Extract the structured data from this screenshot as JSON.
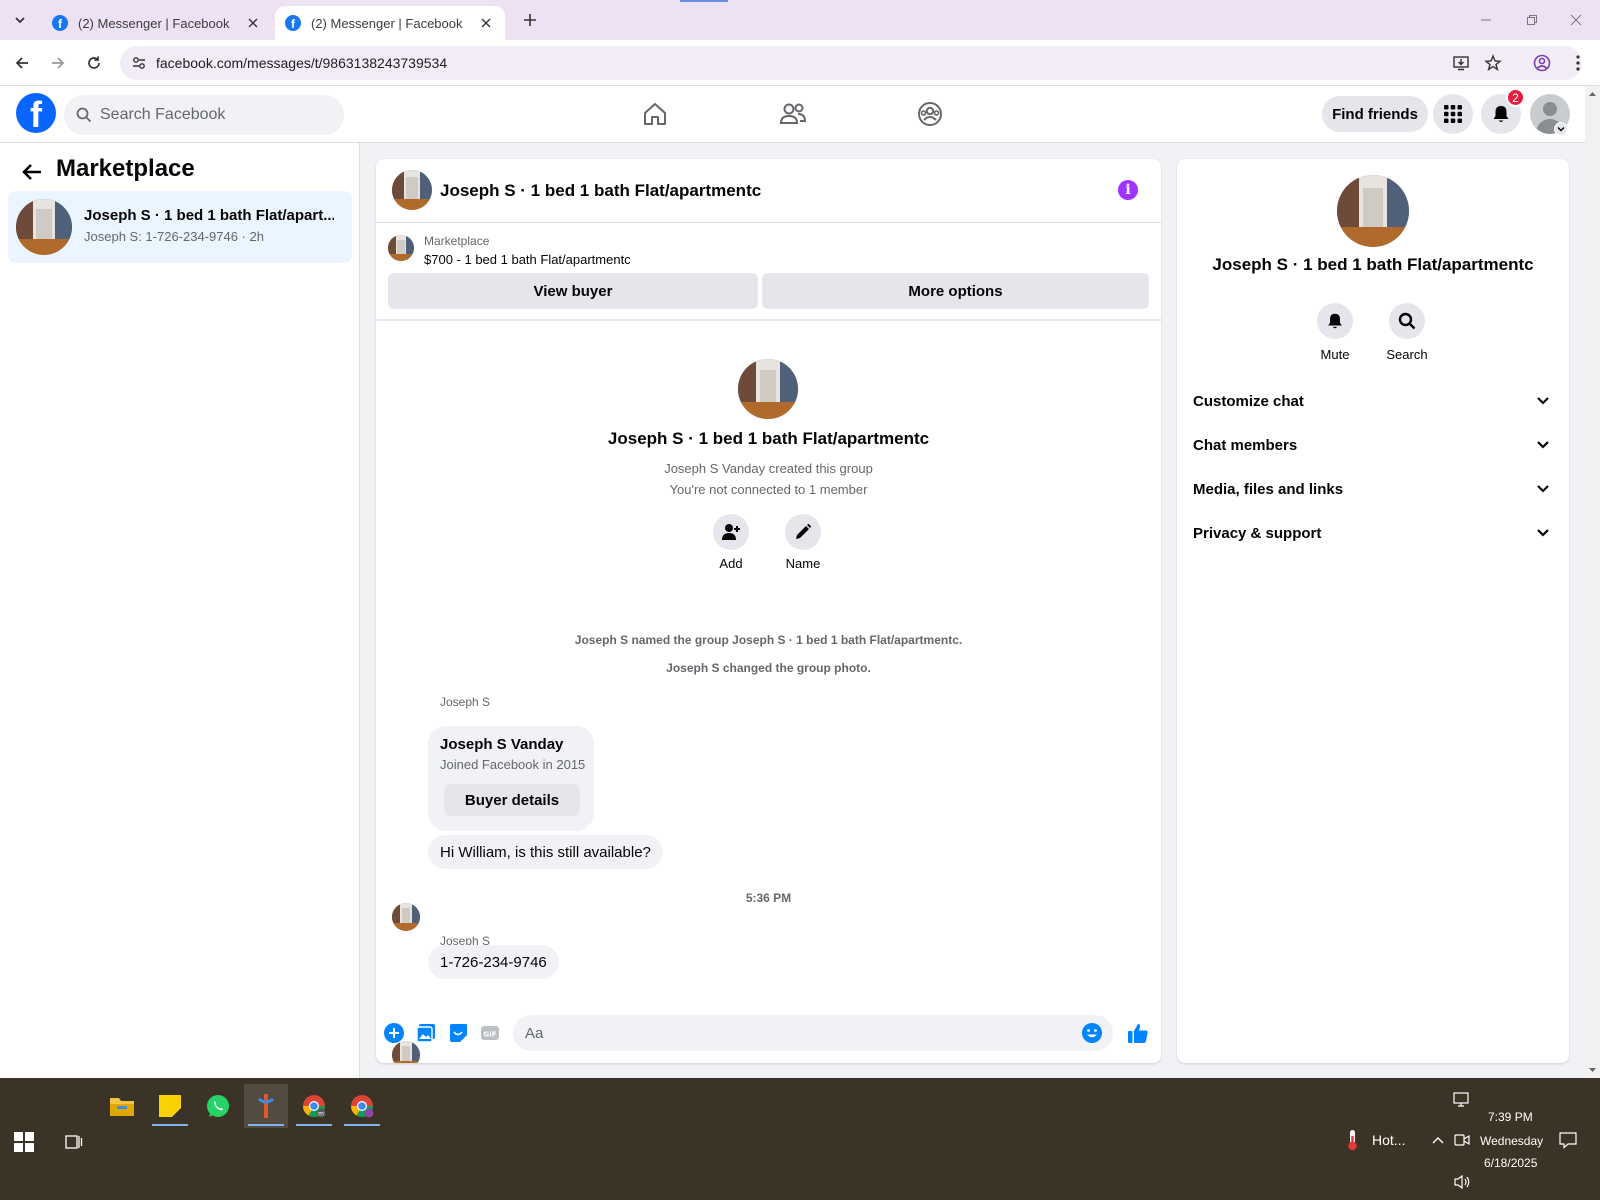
{
  "browser": {
    "tabs": [
      {
        "title": "(2) Messenger | Facebook",
        "active": false
      },
      {
        "title": "(2) Messenger | Facebook",
        "active": true
      }
    ],
    "url": "facebook.com/messages/t/9863138243739534"
  },
  "fb_header": {
    "logo": "f",
    "search_placeholder": "Search Facebook",
    "find_friends_label": "Find friends",
    "notification_count": "2",
    "nav_icons": [
      "home-icon",
      "friends-icon",
      "groups-icon"
    ]
  },
  "left_panel": {
    "title": "Marketplace",
    "conversations": [
      {
        "name": "Joseph S · 1 bed 1 bath Flat/apart...",
        "preview": "Joseph S: 1-726-234-9746 · 2h"
      }
    ]
  },
  "chat": {
    "header_title": "Joseph S · 1 bed 1 bath Flat/apartmentc",
    "listing": {
      "source": "Marketplace",
      "title": "$700 - 1 bed 1 bath Flat/apartmentc",
      "view_buyer_label": "View buyer",
      "more_options_label": "More options"
    },
    "group_intro": {
      "name": "Joseph S · 1 bed 1 bath Flat/apartmentc",
      "created_line": "Joseph S Vanday created this group",
      "connection_line": "You're not connected to 1 member",
      "add_label": "Add",
      "name_label": "Name"
    },
    "system_messages": [
      "Joseph S named the group Joseph S · 1 bed 1 bath Flat/apartmentc.",
      "Joseph S changed the group photo."
    ],
    "buyer_card": {
      "sender": "Joseph S",
      "name": "Joseph S Vanday",
      "joined": "Joined Facebook in 2015",
      "button_label": "Buyer details"
    },
    "messages": [
      {
        "sender": "",
        "text": "Hi William, is this still available?"
      },
      {
        "sender": "Joseph S",
        "text": "1-726-234-9746"
      }
    ],
    "time_separator": "5:36 PM",
    "composer_placeholder": "Aa"
  },
  "right_panel": {
    "name": "Joseph S · 1 bed 1 bath Flat/apartmentc",
    "mute_label": "Mute",
    "search_label": "Search",
    "sections": [
      "Customize chat",
      "Chat members",
      "Media, files and links",
      "Privacy & support"
    ]
  },
  "taskbar": {
    "weather_text": "Hot...",
    "time": "7:39 PM",
    "day": "Wednesday",
    "date": "6/18/2025"
  },
  "colors": {
    "facebook_blue": "#0866ff",
    "messenger_blue": "#0084ff",
    "info_purple": "#a033ff",
    "badge_red": "#e41e3f",
    "selected_conv": "#ebf5ff"
  }
}
